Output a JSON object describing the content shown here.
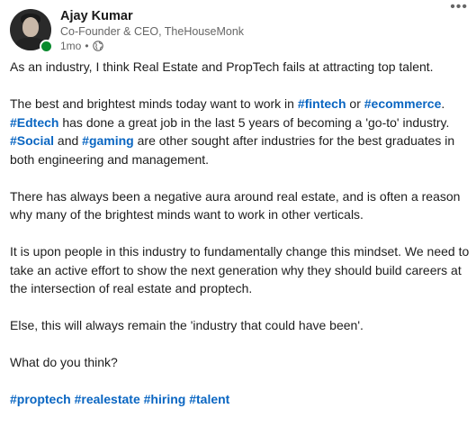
{
  "author": {
    "name": "Ajay Kumar",
    "headline": "Co-Founder & CEO, TheHouseMonk",
    "time": "1mo",
    "separator": "•",
    "visibility_icon": "globe-icon",
    "status_color": "#0a8a2e"
  },
  "menu": {
    "label": "•••"
  },
  "post": {
    "p1": "As an industry, I think Real Estate and PropTech fails at attracting top talent.",
    "p2": {
      "t1": "The best and brightest minds today want to work in ",
      "tag1": "#fintech",
      "t2": " or ",
      "tag2": "#ecommerce",
      "t3": ". ",
      "tag3": "#Edtech",
      "t4": " has done a great job in the last 5 years of becoming a 'go-to' industry. ",
      "tag4": "#Social",
      "t5": " and ",
      "tag5": "#gaming",
      "t6": " are other sought after industries for the best graduates in both engineering and management."
    },
    "p3": "There has always been a negative aura around real estate, and is often a reason why many of the brightest minds want to work in other verticals.",
    "p4": "It is upon people in this industry to fundamentally change this mindset. We need to take an active effort to show the next generation why they should build careers at the intersection of real estate and proptech.",
    "p5": "Else, this will always remain the 'industry that could have been'.",
    "p6": "What do you think?",
    "hashtags": [
      "#proptech",
      "#realestate",
      "#hiring",
      "#talent"
    ]
  },
  "colors": {
    "link": "#0a66c2",
    "text": "#1d1d1d",
    "muted": "#666666"
  }
}
